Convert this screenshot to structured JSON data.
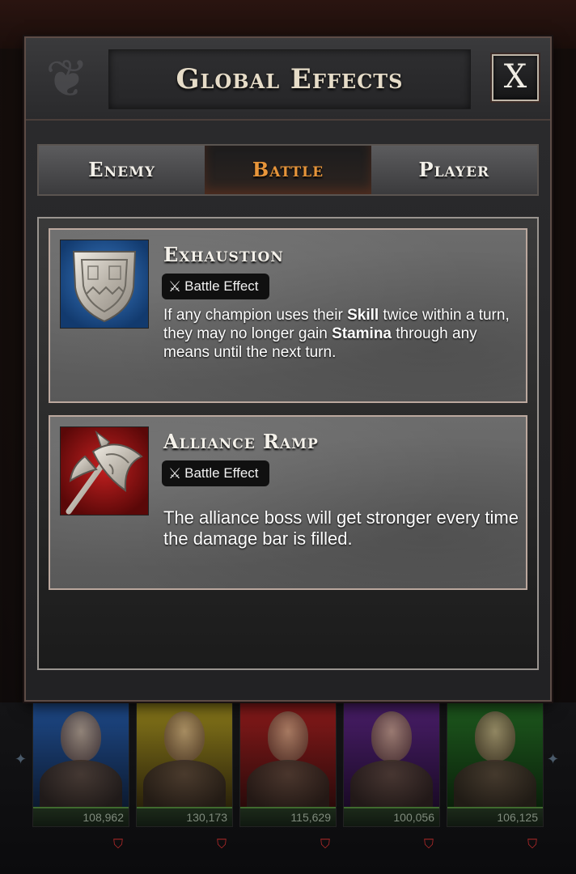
{
  "modal": {
    "title": "Global Effects",
    "close_label": "X"
  },
  "tabs": [
    {
      "label": "Enemy",
      "active": false
    },
    {
      "label": "Battle",
      "active": true
    },
    {
      "label": "Player",
      "active": false
    }
  ],
  "effects": [
    {
      "name": "Exhaustion",
      "badge": "Battle Effect",
      "badge_icon": "crossed-swords-icon",
      "icon": "shield-icon",
      "icon_bg": "#1f5fa8",
      "description_parts": [
        "If any champion uses their ",
        "Skill",
        " twice within a turn, they may no longer gain ",
        "Stamina",
        " through any means until the next turn."
      ]
    },
    {
      "name": "Alliance Ramp",
      "badge": "Battle Effect",
      "badge_icon": "crossed-swords-icon",
      "icon": "axe-icon",
      "icon_bg": "#a31616",
      "description": "The alliance boss will get stronger every time the damage bar is filled."
    }
  ],
  "roster": [
    {
      "power": "108,962",
      "color": "#1e4a8a"
    },
    {
      "power": "130,173",
      "color": "#8a7a1a"
    },
    {
      "power": "115,629",
      "color": "#8a1a1a"
    },
    {
      "power": "100,056",
      "color": "#4a1e6a"
    },
    {
      "power": "106,125",
      "color": "#1e5a1e"
    }
  ]
}
